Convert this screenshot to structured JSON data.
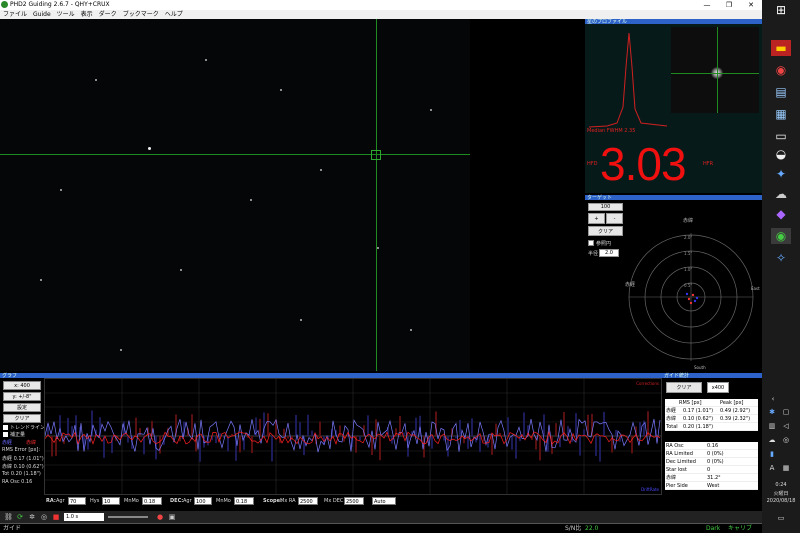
{
  "window": {
    "title": "PHD2 Guiding 2.6.7 - QHY+CRUX",
    "minimize": "—",
    "restore": "❐",
    "close": "✕"
  },
  "menu": [
    "ファイル",
    "Guide",
    "ツール",
    "表示",
    "ダーク",
    "ブックマーク",
    "ヘルプ"
  ],
  "profile": {
    "header": "星のプロファイル",
    "hfd_label": "Median FWHM 2.35",
    "fwhm_value": "3.03",
    "left_unit": "HFD",
    "right_unit": "HFR"
  },
  "target": {
    "header": "ターゲット",
    "zoom": "100",
    "plus": "+",
    "minus": "-",
    "clear": "クリア",
    "show_label": "参照円",
    "scale_label": "半径",
    "scale_value": "2.0",
    "labels": {
      "top": "赤緯",
      "left": "赤経",
      "right": "East",
      "bottom": "South",
      "r1": "0.5\"",
      "r2": "1.0\"",
      "r3": "1.5\"",
      "r4": "2.0\""
    }
  },
  "graph": {
    "header": "グラフ",
    "xscale": "x: 400",
    "yscale": "y: +/-8\"",
    "settings": "設定",
    "clear": "クリア",
    "trendline_label": "トレンドライン",
    "corrections_label": "補正量",
    "ra_legend": "赤経",
    "dec_legend": "赤緯",
    "rms_title": "RMS Error [px]:",
    "rms_ra": "赤経 0.17 (1.01\")",
    "rms_dec": "赤緯 0.10 (0.62\")",
    "rms_tot": "Tot 0.20 (1.18\")",
    "ra_osc": "RA Osc 0.16",
    "plot_top_right": "Corrections",
    "plot_bottom_right": "DriftRate",
    "params": {
      "ra_label": "RA:",
      "agr_label": "Agr",
      "agr_val": "70",
      "hys_label": "Hys",
      "hys_val": "10",
      "minmo_label": "MnMo",
      "minmo_val": "0.18",
      "dec_label": "DEC:",
      "dec_agr_label": "Agr",
      "dec_agr_val": "100",
      "dec_minmo_label": "MnMo",
      "dec_minmo_val": "0.18",
      "scope_label": "Scope:",
      "mxra_label": "Mx RA",
      "mxra_val": "2500",
      "mxdec_label": "Mx DEC",
      "mxdec_val": "2500",
      "mode_val": "Auto"
    }
  },
  "stats": {
    "header": "ガイド統計",
    "clear": "クリア",
    "range": "x400",
    "col_rms": "RMS [px]",
    "col_peak": "Peak [px]",
    "rows": [
      {
        "name": "赤経",
        "rms": "0.17 (1.01\")",
        "peak": "0.49 (2.92\")"
      },
      {
        "name": "赤緯",
        "rms": "0.10 (0.62\")",
        "peak": "0.39 (2.32\")"
      },
      {
        "name": "Total",
        "rms": "0.20 (1.18\")",
        "peak": ""
      }
    ],
    "rows2": [
      {
        "k": "RA Osc",
        "v": "0.16"
      },
      {
        "k": "RA Limited",
        "v": "0 (0%)"
      },
      {
        "k": "Dec Limited",
        "v": "0 (0%)"
      },
      {
        "k": "Star lost",
        "v": "0"
      },
      {
        "k": "赤緯",
        "v": "31.2°"
      },
      {
        "k": "Pier Side",
        "v": "West"
      }
    ]
  },
  "toolbar": {
    "exposure": "1.0 s"
  },
  "status": {
    "left": "ガイド",
    "snr_label": "S/N比",
    "snr_val": "22.0",
    "dark": "Dark",
    "cal": "キャリブ"
  },
  "taskbar": {
    "time": "0:24",
    "day": "火曜日",
    "date": "2020/08/18",
    "lang": "A"
  }
}
